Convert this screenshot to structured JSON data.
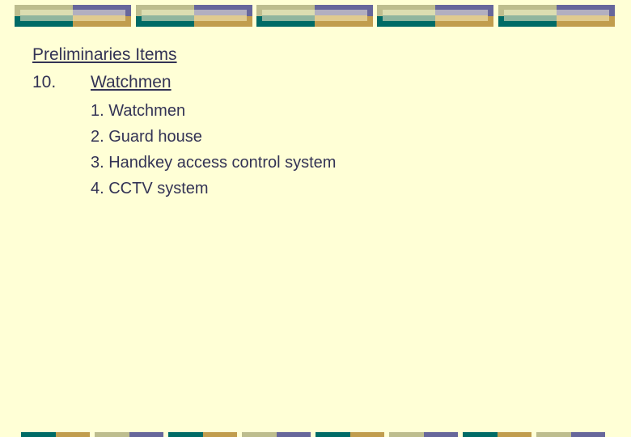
{
  "slide": {
    "title": "Preliminaries Items",
    "section_number": "10.",
    "section_heading": "Watchmen",
    "items": [
      "1. Watchmen",
      "2. Guard house",
      "3. Handkey access control system",
      "4. CCTV system"
    ]
  },
  "theme": {
    "background": "#FFFFD6",
    "text": "#333355",
    "khaki": "#BDBD8E",
    "slate_purple": "#67679B",
    "teal": "#006B66",
    "gold": "#C19D4E"
  }
}
